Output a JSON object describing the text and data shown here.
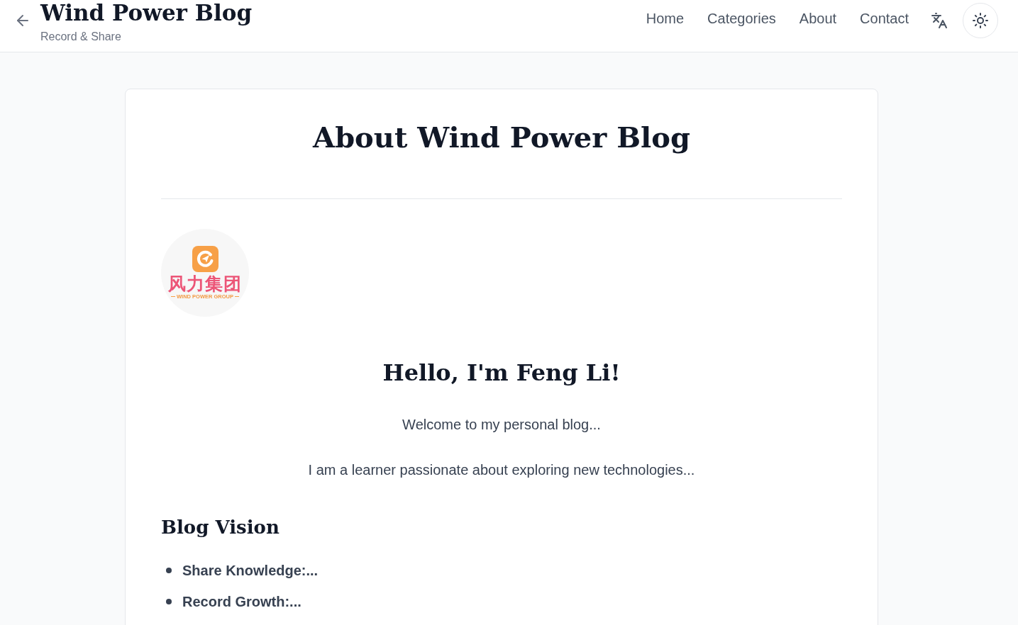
{
  "header": {
    "title": "Wind Power Blog",
    "subtitle": "Record & Share",
    "nav": [
      "Home",
      "Categories",
      "About",
      "Contact"
    ]
  },
  "card": {
    "title": "About Wind Power Blog",
    "avatar": {
      "name": "风力集团",
      "tagline": "WIND POWER GROUP"
    },
    "greeting": "Hello, I'm Feng Li!",
    "paragraphs": [
      "Welcome to my personal blog...",
      "I am a learner passionate about exploring new technologies..."
    ],
    "sections": [
      {
        "heading": "Blog Vision",
        "items": [
          "Share Knowledge:...",
          "Record Growth:..."
        ]
      }
    ]
  }
}
